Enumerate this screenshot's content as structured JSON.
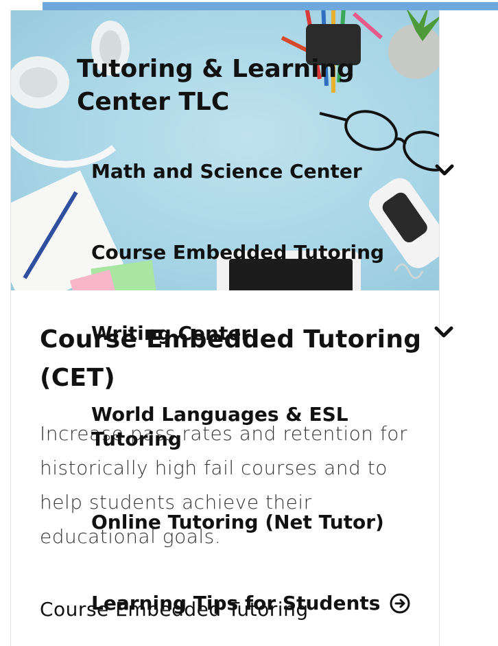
{
  "site": {
    "title": "Tutoring & Learning Center TLC"
  },
  "menu": {
    "items": [
      {
        "label": "Math and Science Center",
        "has_submenu": true
      },
      {
        "label": "Course Embedded Tutoring",
        "has_submenu": false
      },
      {
        "label": "Writing Center",
        "has_submenu": true
      },
      {
        "label": "World Languages & ESL Tutoring",
        "has_submenu": false
      },
      {
        "label": "Online Tutoring (Net Tutor)",
        "has_submenu": false
      },
      {
        "label": "Learning Tips for Students",
        "has_submenu": false
      }
    ]
  },
  "page": {
    "heading": "Course Embedded Tutoring (CET)",
    "description": "Increase pass rates and retention for historically high fail courses and to help students achieve their educational goals.",
    "subheading": "Course Embedded Tutoring"
  },
  "colors": {
    "accent_bar": "#6fa8dc",
    "text": "#111111",
    "hero_bg": "#a9d6e6"
  },
  "icons": {
    "submenu": "chevron-down-icon",
    "link": "arrow-circle-right-icon"
  }
}
